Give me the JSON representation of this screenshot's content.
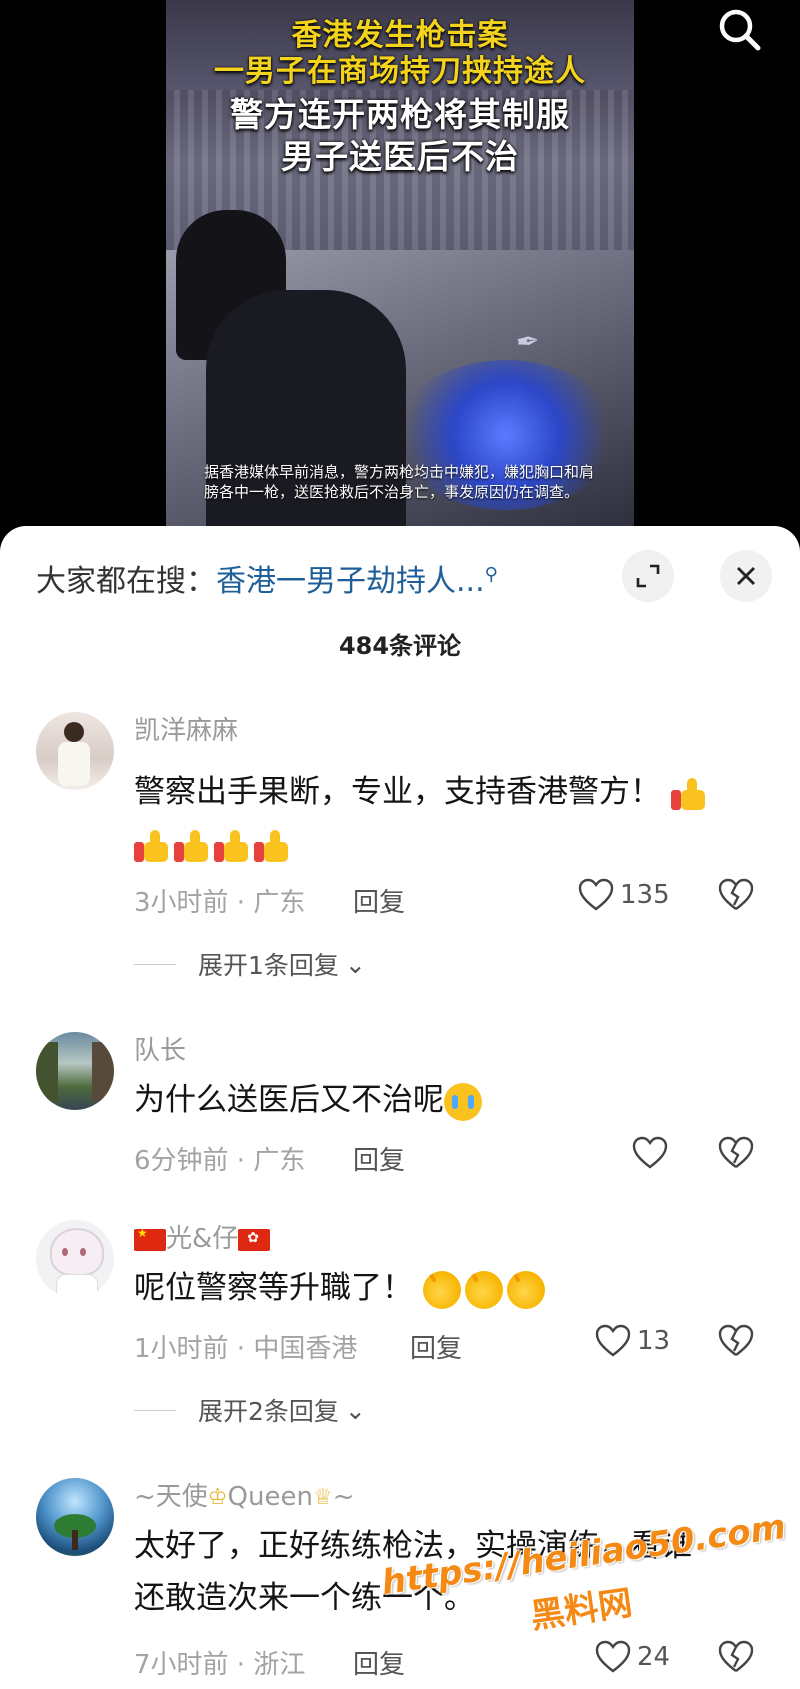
{
  "video": {
    "caption_line1": "香港发生枪击案",
    "caption_line2": "一男子在商场持刀挟持途人",
    "caption_line3": "警方连开两枪将其制服",
    "caption_line4": "男子送医后不治",
    "subtitle": "据香港媒体早前消息，警方两枪均击中嫌犯，嫌犯胸口和肩膀各中一枪，送医抢救后不治身亡，事发原因仍在调查。"
  },
  "header": {
    "trend_prefix": "大家都在搜：",
    "trend_keyword": "香港一男子劫持人...",
    "comment_count": "484条评论"
  },
  "comments": [
    {
      "user": "凯洋麻麻",
      "text": "警察出手果断，专业，支持香港警方！",
      "time": "3小时前 · 广东",
      "reply": "回复",
      "likes": "135",
      "expand": "展开1条回复"
    },
    {
      "user": "队长",
      "text": "为什么送医后又不治呢",
      "time": "6分钟前 · 广东",
      "reply": "回复",
      "likes": ""
    },
    {
      "user": "光&仔",
      "text": "呢位警察等升職了！",
      "time": "1小时前 · 中国香港",
      "reply": "回复",
      "likes": "13",
      "expand": "展开2条回复"
    },
    {
      "user_prefix": "~天使",
      "user_mid": "Queen",
      "user_suffix": "~",
      "text_line1": "太好了，正好练练枪法，实操演练，看谁",
      "text_line2": "还敢造次来一个练一个。",
      "time": "7小时前 · 浙江",
      "reply": "回复",
      "likes": "24"
    }
  ],
  "watermark": {
    "line1": "https://heiliao50.com",
    "line2": "黑料网"
  },
  "colors": {
    "keyword_blue": "#1f5f99",
    "caption_yellow": "#f4d31c",
    "watermark_orange": "#f48a14"
  }
}
